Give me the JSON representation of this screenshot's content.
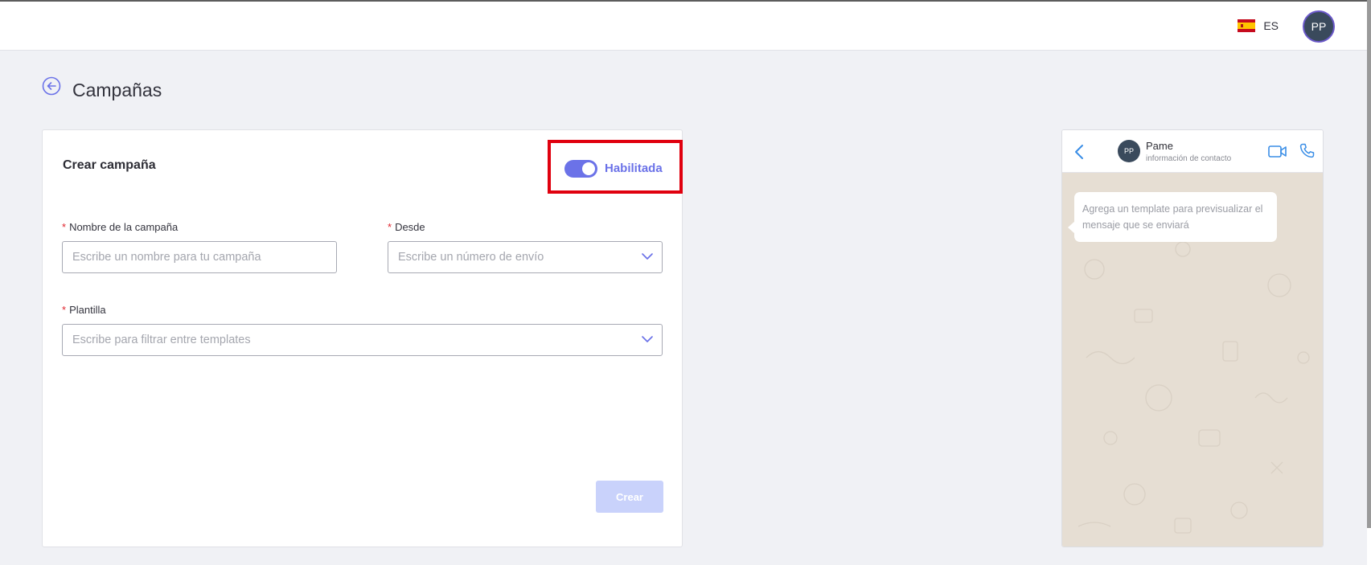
{
  "topbar": {
    "language": "ES",
    "avatar_initials": "PP",
    "flag_icon": "spain-flag-icon"
  },
  "page": {
    "title": "Campañas"
  },
  "form": {
    "card_title": "Crear campaña",
    "toggle_label": "Habilitada",
    "toggle_on": true,
    "campaign_name_label": "Nombre de la campaña",
    "campaign_name_placeholder": "Escribe un nombre para tu campaña",
    "from_label": "Desde",
    "from_placeholder": "Escribe un número de envío",
    "template_label": "Plantilla",
    "template_placeholder": "Escribe para filtrar entre templates",
    "required_mark": "*",
    "create_button": "Crear"
  },
  "preview": {
    "contact_initials": "PP",
    "contact_name": "Pame",
    "contact_subtitle": "información de contacto",
    "message": "Agrega un template para previsualizar el mensaje que se enviará"
  },
  "colors": {
    "accent": "#6b72e8",
    "highlight_border": "#e0000e",
    "button_disabled": "#c9d2fb",
    "chat_background": "#e6ded3",
    "avatar": "#3a4a5c"
  }
}
